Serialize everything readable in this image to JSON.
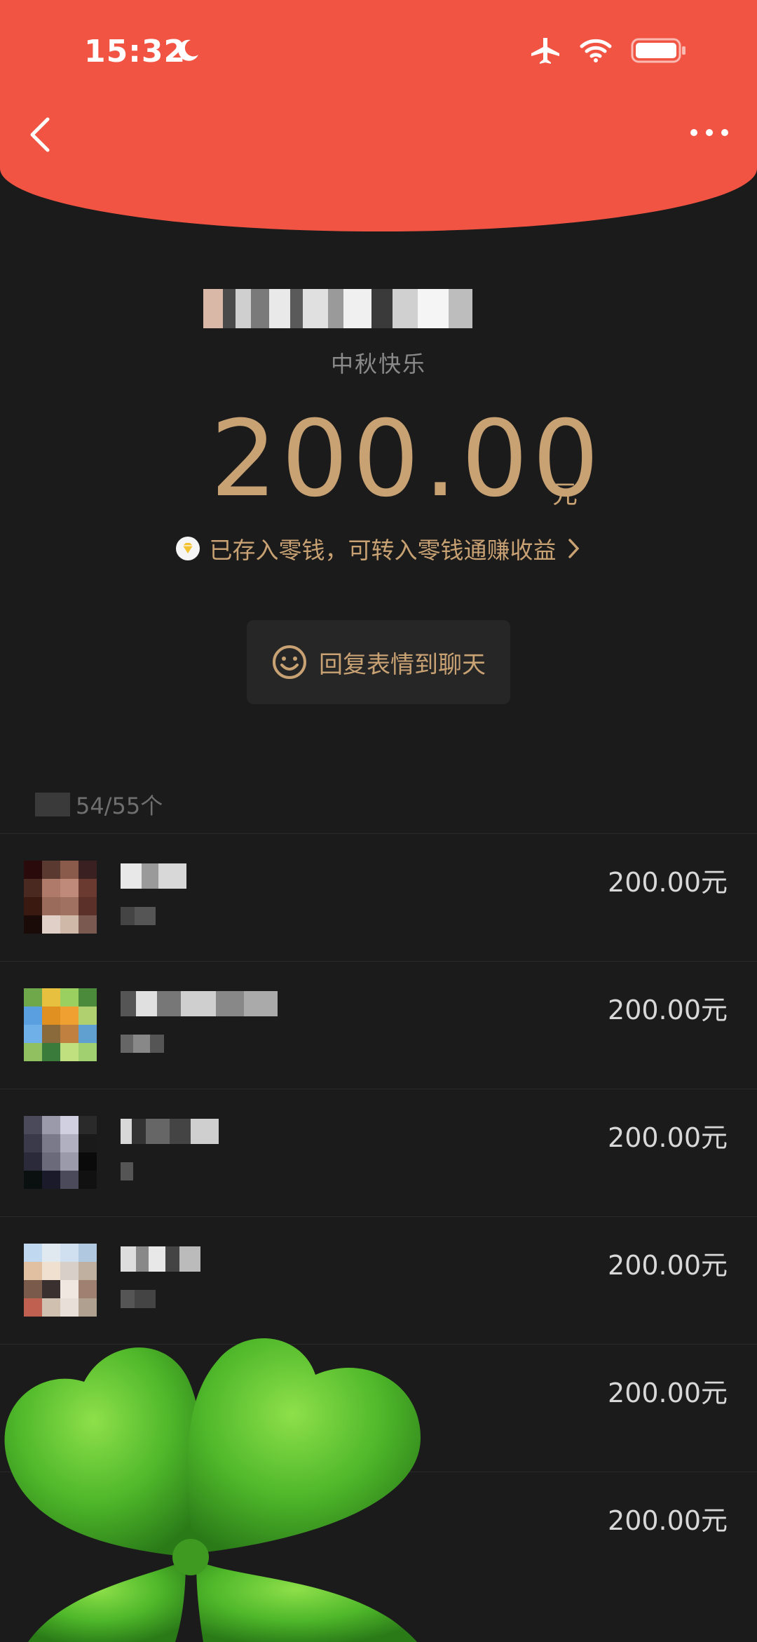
{
  "status_bar": {
    "time": "15:32"
  },
  "envelope": {
    "greeting": "中秋快乐",
    "amount": "200.00",
    "unit": "元",
    "saved_text": "已存入零钱，可转入零钱通赚收益",
    "reply_label": "回复表情到聊天"
  },
  "receivers": {
    "count_text": "54/55个",
    "items": [
      {
        "amount": "200.00元"
      },
      {
        "amount": "200.00元"
      },
      {
        "amount": "200.00元"
      },
      {
        "amount": "200.00元"
      },
      {
        "amount": "200.00元"
      },
      {
        "amount": "200.00元"
      }
    ]
  },
  "colors": {
    "header_red": "#f25443",
    "gold": "#c9a274",
    "background": "#1b1b1b"
  }
}
